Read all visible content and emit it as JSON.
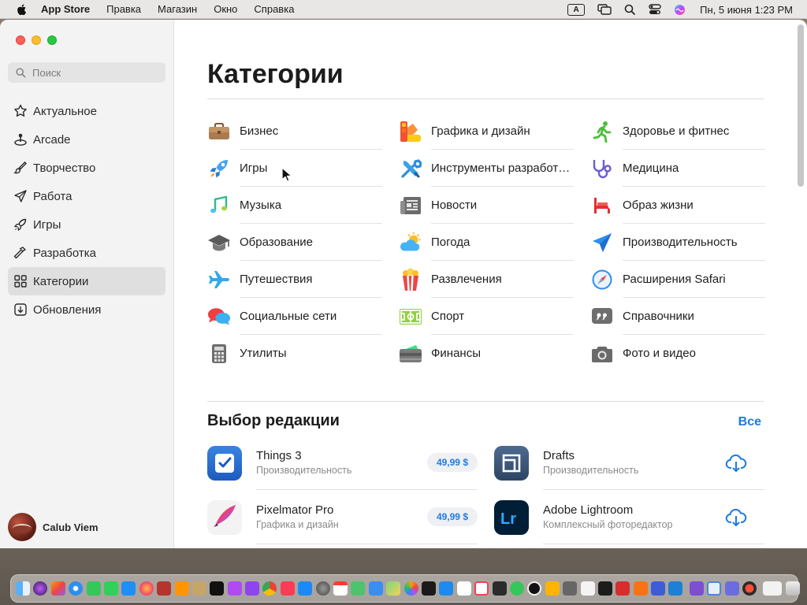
{
  "menubar": {
    "app_name": "App Store",
    "items": [
      "Правка",
      "Магазин",
      "Окно",
      "Справка"
    ],
    "input_source": "A",
    "clock": "Пн, 5 июня  1:23 PM"
  },
  "sidebar": {
    "search_placeholder": "Поиск",
    "items": [
      {
        "label": "Актуальное",
        "icon": "star-icon"
      },
      {
        "label": "Arcade",
        "icon": "joystick-icon"
      },
      {
        "label": "Творчество",
        "icon": "brush-icon"
      },
      {
        "label": "Работа",
        "icon": "paper-plane-icon"
      },
      {
        "label": "Игры",
        "icon": "rocket-icon"
      },
      {
        "label": "Разработка",
        "icon": "hammer-icon"
      },
      {
        "label": "Категории",
        "icon": "grid-icon",
        "active": true
      },
      {
        "label": "Обновления",
        "icon": "download-icon"
      }
    ],
    "user": "Calub Viem"
  },
  "main": {
    "title": "Категории",
    "categories": [
      [
        "Бизнес",
        "Игры",
        "Музыка",
        "Образование",
        "Путешествия",
        "Социальные сети",
        "Утилиты"
      ],
      [
        "Графика и дизайн",
        "Инструменты разработчика",
        "Новости",
        "Погода",
        "Развлечения",
        "Спорт",
        "Финансы"
      ],
      [
        "Здоровье и фитнес",
        "Медицина",
        "Образ жизни",
        "Производительность",
        "Расширения Safari",
        "Справочники",
        "Фото и видео"
      ]
    ],
    "editors_choice": {
      "title": "Выбор редакции",
      "see_all": "Все",
      "apps": [
        {
          "name": "Things 3",
          "category": "Производительность",
          "price": "49,99 $"
        },
        {
          "name": "Drafts",
          "category": "Производительность",
          "action": "download"
        },
        {
          "name": "Pixelmator Pro",
          "category": "Графика и дизайн",
          "price": "49,99 $"
        },
        {
          "name": "Adobe Lightroom",
          "category": "Комплексный фоторедактор",
          "action": "download"
        }
      ]
    }
  },
  "colors": {
    "accent": "#1f7ae0",
    "sidebar_bg": "#f4f3f3",
    "active_item_bg": "#e0dfdf"
  },
  "dock": {
    "icon_count": 46
  }
}
